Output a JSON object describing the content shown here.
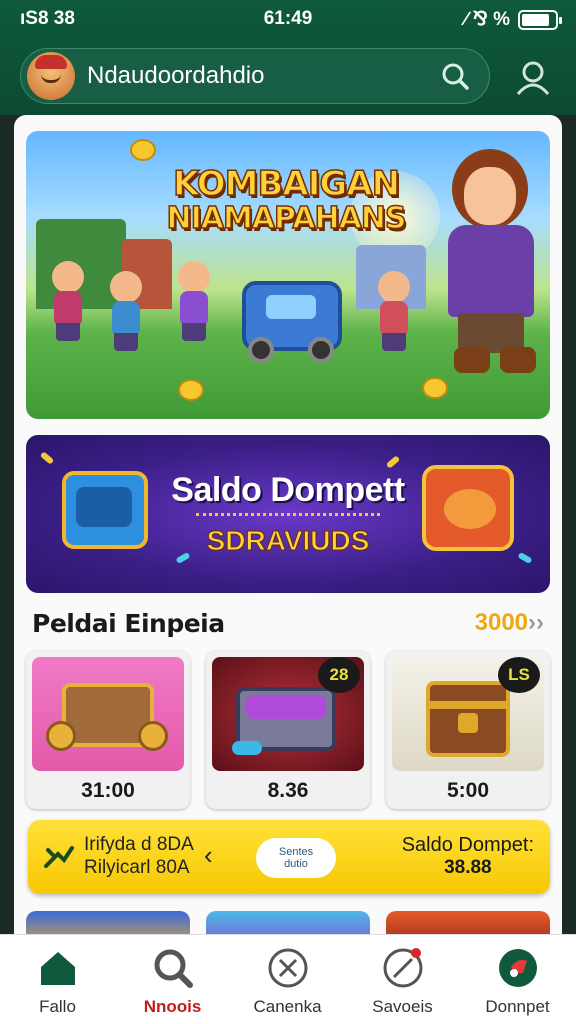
{
  "status_bar": {
    "left": "ıS8 38",
    "center": "61:49",
    "right": "∕ ⅋ %",
    "battery_level": 0.85
  },
  "header": {
    "search_value": "Ndaudoordahdio",
    "icons": [
      "avatar",
      "search-icon",
      "profile-icon"
    ]
  },
  "hero": {
    "title_line1": "KOMBAIGAN",
    "title_line2": "NIAMAPAHANS"
  },
  "promo": {
    "title": "Saldo Dompett",
    "subtitle": "SDRAVIUDS"
  },
  "section": {
    "title": "Peldai Einpeia",
    "more": "3000",
    "more_arrow": "››"
  },
  "cards": [
    {
      "price": "31:00",
      "badge": ""
    },
    {
      "price": "8.36",
      "badge": "28"
    },
    {
      "price": "5:00",
      "badge": "LS"
    }
  ],
  "wallet": {
    "line1": "Irifyda d 8DA",
    "line2": "Rilyicarl 80A",
    "pill_line1": "Sentes",
    "pill_line2": "dutio",
    "label": "Saldo Dompet:",
    "value": "38.88"
  },
  "bottom_nav": [
    {
      "label": "Fallo",
      "icon": "home-icon",
      "active": false
    },
    {
      "label": "Nnoois",
      "icon": "search-icon",
      "active": true
    },
    {
      "label": "Canenka",
      "icon": "close-circle-icon",
      "active": false
    },
    {
      "label": "Savoeis",
      "icon": "edit-icon",
      "active": false
    },
    {
      "label": "Donnpet",
      "icon": "wallet-icon",
      "active": false
    }
  ],
  "colors": {
    "primary": "#0b4a31",
    "accent": "#f7c800",
    "active_nav": "#c01e1e",
    "nav_icon": "#0f5a3c"
  }
}
